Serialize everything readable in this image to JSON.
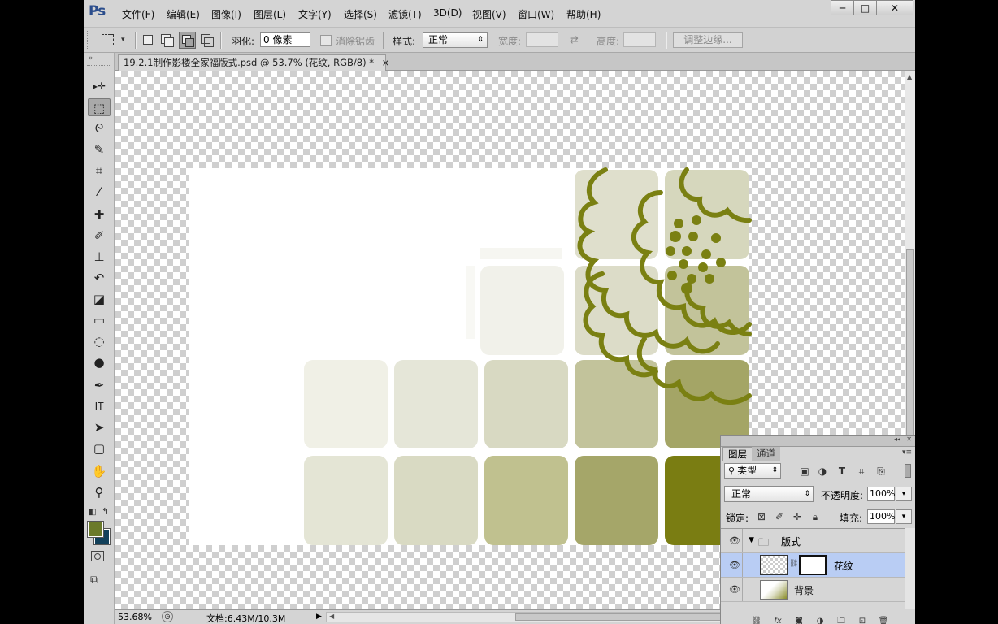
{
  "app": {
    "logo": "Ps",
    "menu": [
      "文件(F)",
      "编辑(E)",
      "图像(I)",
      "图层(L)",
      "文字(Y)",
      "选择(S)",
      "滤镜(T)",
      "3D(D)",
      "视图(V)",
      "窗口(W)",
      "帮助(H)"
    ],
    "window_buttons": {
      "minimize": "─",
      "maximize": "□",
      "close": "✕"
    }
  },
  "options": {
    "feather_label": "羽化:",
    "feather_value": "0 像素",
    "antialias_label": "消除锯齿",
    "style_label": "样式:",
    "style_value": "正常",
    "width_label": "宽度:",
    "height_label": "高度:",
    "refine_edge": "调整边缘..."
  },
  "document": {
    "tab_title": "19.2.1制作影楼全家福版式.psd @ 53.7% (花纹, RGB/8) *",
    "close": "×"
  },
  "tools": [
    {
      "name": "move-tool-icon",
      "glyph": "▸✛"
    },
    {
      "name": "marquee-tool-icon",
      "glyph": "⬚",
      "active": true
    },
    {
      "name": "lasso-tool-icon",
      "glyph": "ᘓ"
    },
    {
      "name": "quick-selection-tool-icon",
      "glyph": "✎"
    },
    {
      "name": "crop-tool-icon",
      "glyph": "⌗"
    },
    {
      "name": "eyedropper-tool-icon",
      "glyph": "⁄"
    },
    {
      "name": "healing-brush-tool-icon",
      "glyph": "✚"
    },
    {
      "name": "brush-tool-icon",
      "glyph": "✐"
    },
    {
      "name": "clone-stamp-tool-icon",
      "glyph": "⊥"
    },
    {
      "name": "history-brush-tool-icon",
      "glyph": "↶"
    },
    {
      "name": "eraser-tool-icon",
      "glyph": "◪"
    },
    {
      "name": "gradient-tool-icon",
      "glyph": "▭"
    },
    {
      "name": "blur-tool-icon",
      "glyph": "◌"
    },
    {
      "name": "dodge-tool-icon",
      "glyph": "●"
    },
    {
      "name": "pen-tool-icon",
      "glyph": "✒"
    },
    {
      "name": "type-tool-icon",
      "glyph": "IT"
    },
    {
      "name": "path-selection-tool-icon",
      "glyph": "➤"
    },
    {
      "name": "shape-tool-icon",
      "glyph": "▢"
    },
    {
      "name": "hand-tool-icon",
      "glyph": "✋"
    },
    {
      "name": "zoom-tool-icon",
      "glyph": "⚲"
    }
  ],
  "colors": {
    "foreground": "#6b7a2a",
    "background": "#12405a",
    "ornament": "#7a8012",
    "tiles": [
      "#ebebdf",
      "#dcdcc7",
      "#c3c49b",
      "#a6a76b",
      "#7a7d12"
    ]
  },
  "status": {
    "zoom": "53.68%",
    "doc_size": "文档:6.43M/10.3M"
  },
  "layers_panel": {
    "tabs": [
      "图层",
      "通道"
    ],
    "filter_kind": "类型",
    "blend_mode": "正常",
    "opacity_label": "不透明度:",
    "opacity_value": "100%",
    "lock_label": "锁定:",
    "fill_label": "填充:",
    "fill_value": "100%",
    "layers": [
      {
        "name": "版式",
        "type": "group"
      },
      {
        "name": "花纹",
        "type": "masked",
        "selected": true
      },
      {
        "name": "背景",
        "type": "image"
      }
    ]
  }
}
